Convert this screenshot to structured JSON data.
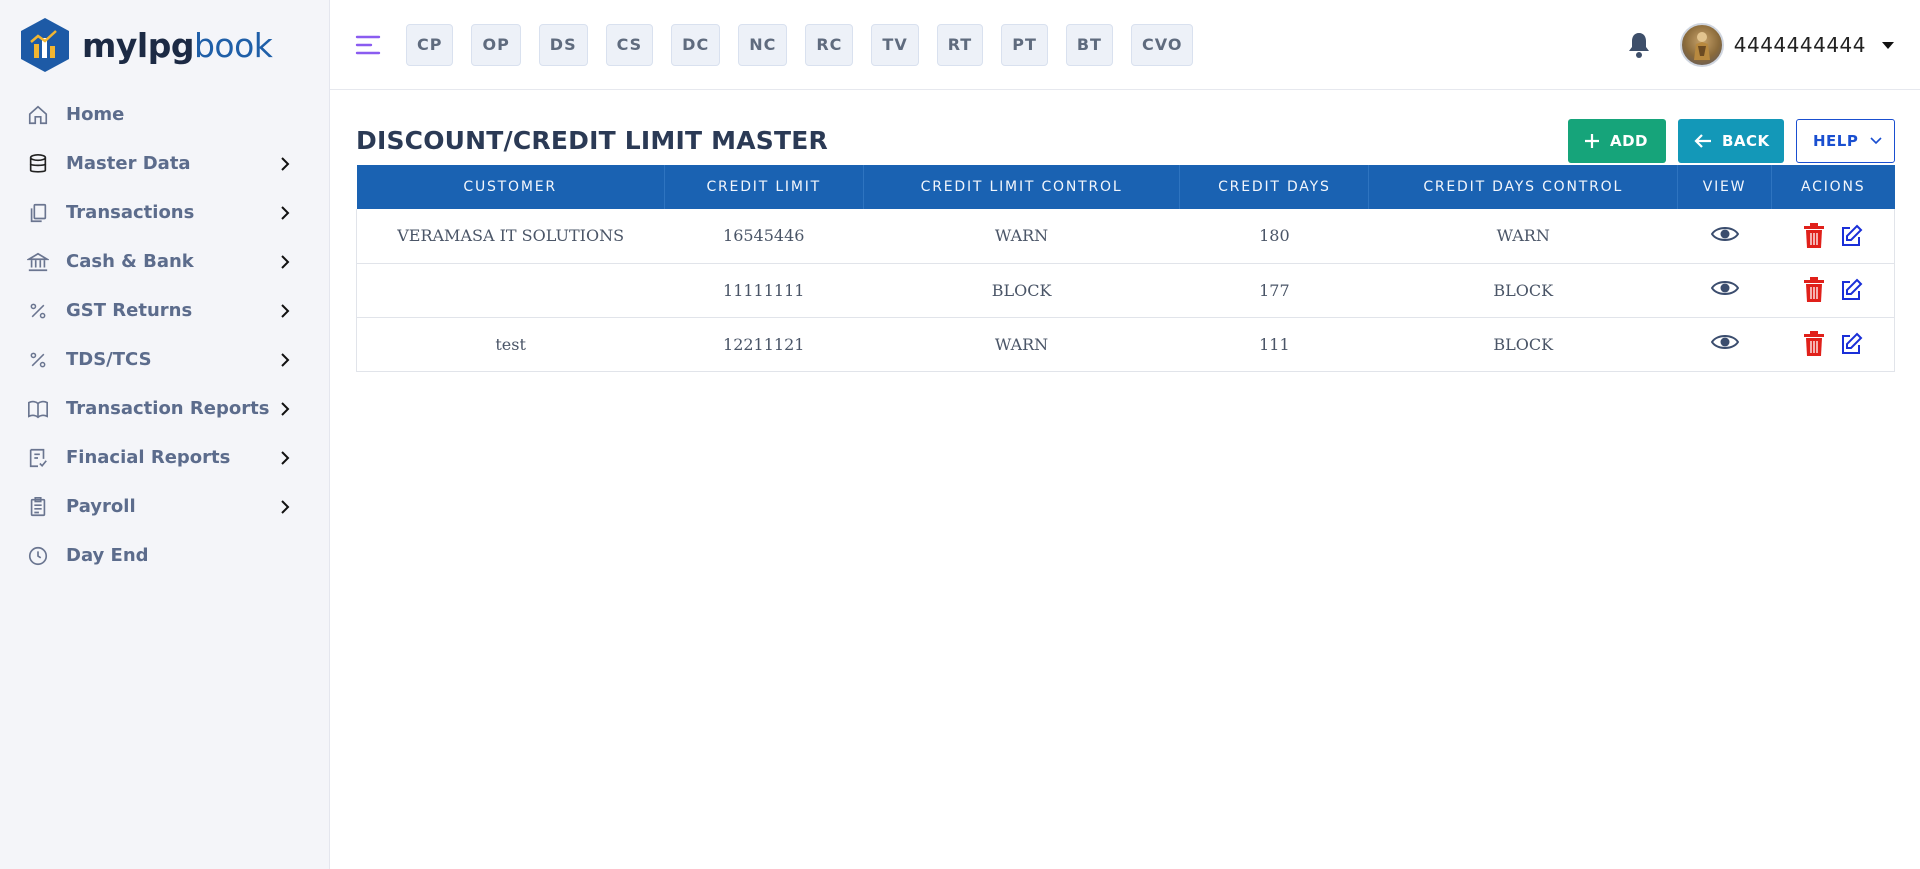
{
  "brand": {
    "part1": "mylpg",
    "part2": "book"
  },
  "sidebar": {
    "items": [
      {
        "label": "Home",
        "icon": "home-icon"
      },
      {
        "label": "Master Data",
        "icon": "database-icon"
      },
      {
        "label": "Transactions",
        "icon": "copy-icon"
      },
      {
        "label": "Cash & Bank",
        "icon": "bank-icon"
      },
      {
        "label": "GST Returns",
        "icon": "percent-icon"
      },
      {
        "label": "TDS/TCS",
        "icon": "percent-icon"
      },
      {
        "label": "Transaction Reports",
        "icon": "book-icon"
      },
      {
        "label": "Finacial Reports",
        "icon": "checklist-icon"
      },
      {
        "label": "Payroll",
        "icon": "clipboard-icon"
      },
      {
        "label": "Day End",
        "icon": "clock-icon"
      }
    ]
  },
  "topbar": {
    "quick_links": [
      "CP",
      "OP",
      "DS",
      "CS",
      "DC",
      "NC",
      "RC",
      "TV",
      "RT",
      "PT",
      "BT",
      "CVO"
    ],
    "username": "4444444444"
  },
  "page": {
    "title": "DISCOUNT/CREDIT LIMIT MASTER",
    "add_label": "ADD",
    "back_label": "BACK",
    "help_label": "HELP"
  },
  "table": {
    "headers": [
      "CUSTOMER",
      "CREDIT LIMIT",
      "CREDIT LIMIT CONTROL",
      "CREDIT DAYS",
      "CREDIT DAYS CONTROL",
      "VIEW",
      "ACIONS"
    ],
    "rows": [
      {
        "customer": "VERAMASA IT SOLUTIONS",
        "credit_limit": "16545446",
        "credit_limit_control": "WARN",
        "credit_days": "180",
        "credit_days_control": "WARN"
      },
      {
        "customer": "",
        "credit_limit": "11111111",
        "credit_limit_control": "BLOCK",
        "credit_days": "177",
        "credit_days_control": "BLOCK"
      },
      {
        "customer": "test",
        "credit_limit": "12211121",
        "credit_limit_control": "WARN",
        "credit_days": "111",
        "credit_days_control": "BLOCK"
      }
    ]
  },
  "colors": {
    "header_blue": "#1a62b2",
    "add_green": "#16a47a",
    "back_teal": "#1398b8",
    "delete_red": "#e0201a",
    "edit_blue": "#1a2fd8"
  }
}
